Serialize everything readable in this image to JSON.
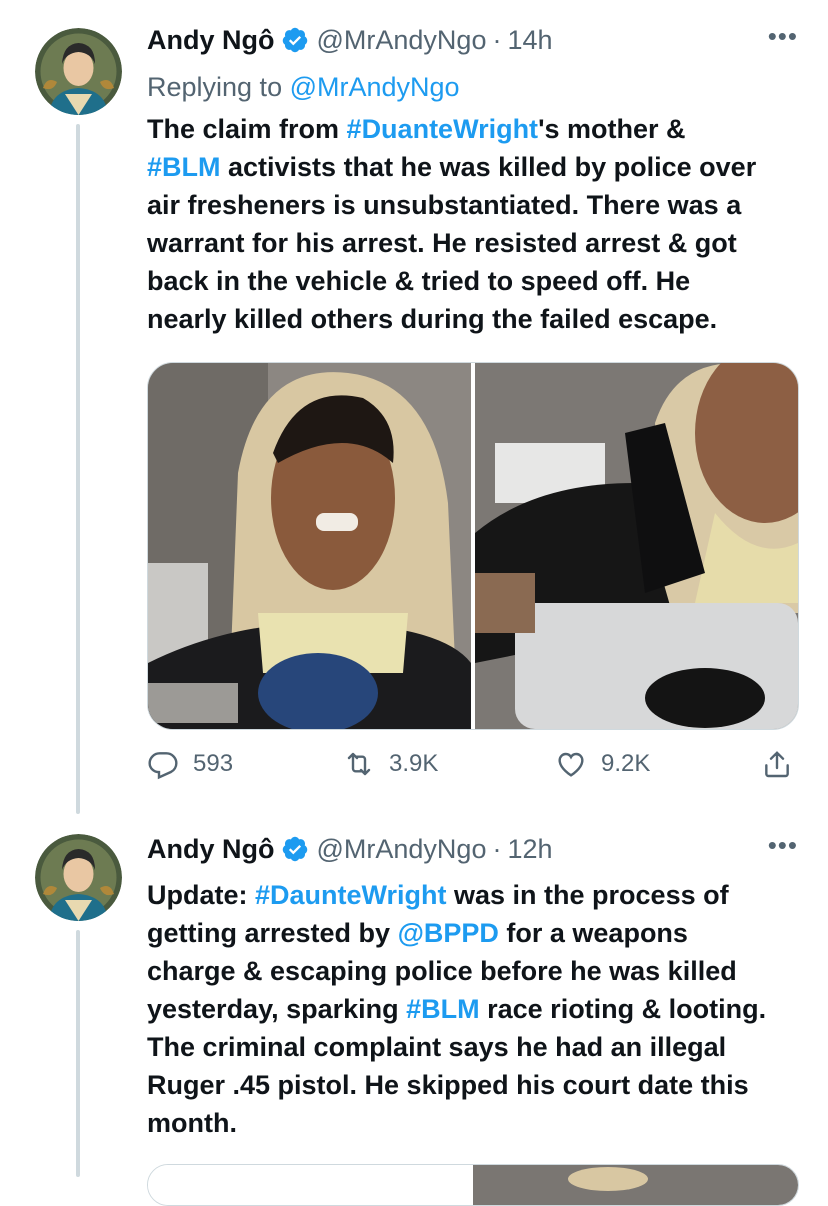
{
  "tweets": [
    {
      "name": "Andy Ngô",
      "handle": "@MrAndyNgo",
      "separator": "·",
      "time": "14h",
      "more": "•••",
      "reply_prefix": "Replying to",
      "reply_handle": "@MrAndyNgo",
      "text": {
        "p1": "The claim from ",
        "tag1": "#DuanteWright",
        "p2": "'s mother &",
        "tag2": "#BLM",
        "p3": " activists that he was killed by police over",
        "l3": "air fresheners is unsubstantiated. There was a",
        "l4": "warrant for his arrest. He resisted arrest & got",
        "l5": "back in the vehicle & tried to speed off. He",
        "l6": "nearly killed others during the failed escape."
      },
      "stats": {
        "replies": "593",
        "retweets": "3.9K",
        "likes": "9.2K"
      }
    },
    {
      "name": "Andy Ngô",
      "handle": "@MrAndyNgo",
      "separator": "·",
      "time": "12h",
      "more": "•••",
      "text": {
        "p1": "Update: ",
        "tag1": "#DaunteWright",
        "p2": " was in the process of",
        "p3": "getting arrested by ",
        "mention1": "@BPPD",
        "p4": " for a weapons",
        "l3": "charge & escaping police before he was killed",
        "p5": "yesterday, sparking ",
        "tag2": "#BLM",
        "p6": " race rioting & looting.",
        "l5": "The criminal complaint says he had an illegal",
        "l6": "Ruger .45 pistol. He skipped his court date this",
        "l7": "month."
      }
    }
  ],
  "icons": {
    "verified": "verified-badge-icon",
    "reply": "reply-icon",
    "retweet": "retweet-icon",
    "like": "heart-icon",
    "share": "share-icon"
  },
  "colors": {
    "accent": "#1d9bf0",
    "text": "#0f1419",
    "secondary": "#536471",
    "border": "#cfd9de"
  }
}
